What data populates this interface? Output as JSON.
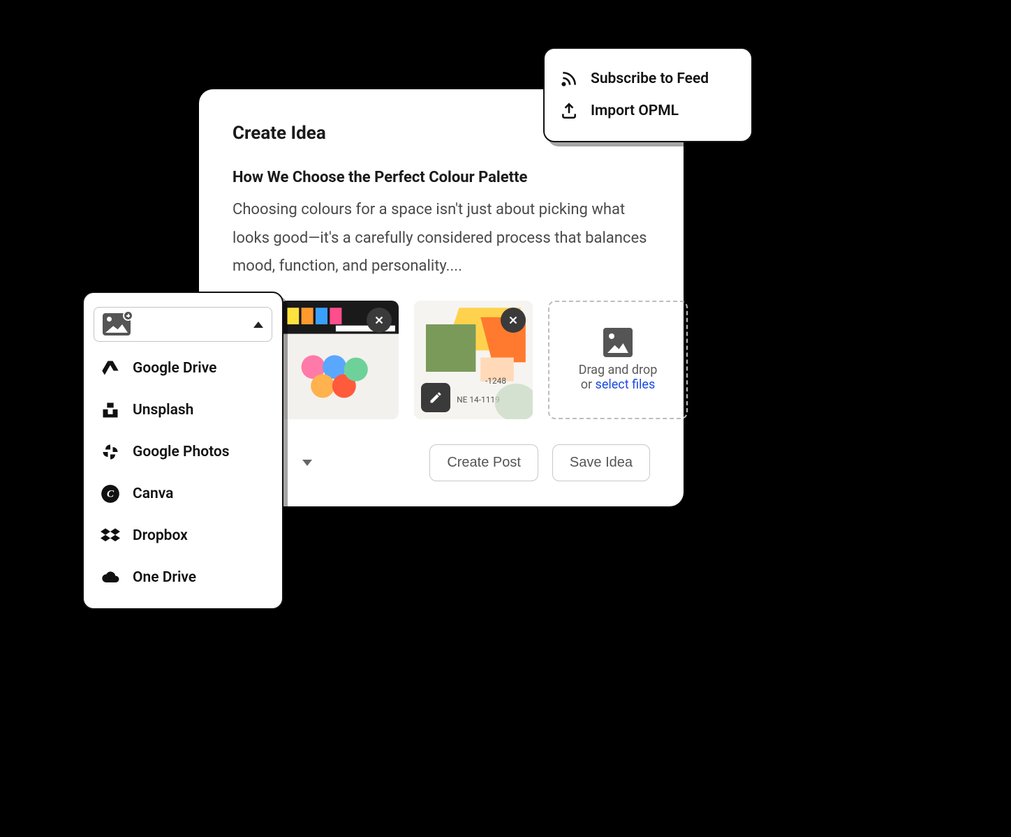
{
  "feed_menu": {
    "subscribe": "Subscribe to Feed",
    "import": "Import OPML"
  },
  "main": {
    "heading": "Create Idea",
    "idea_title": "How We Choose the Perfect Colour Palette",
    "idea_desc": "Choosing colours for a space isn't just about picking what looks good—it's a carefully considered process that balances mood, function, and personality....",
    "dropzone": {
      "line1": "Drag and drop",
      "or": "or ",
      "link": "select files"
    },
    "buttons": {
      "create": "Create Post",
      "save": "Save Idea"
    }
  },
  "sources": {
    "items": [
      "Google Drive",
      "Unsplash",
      "Google Photos",
      "Canva",
      "Dropbox",
      "One Drive"
    ]
  }
}
